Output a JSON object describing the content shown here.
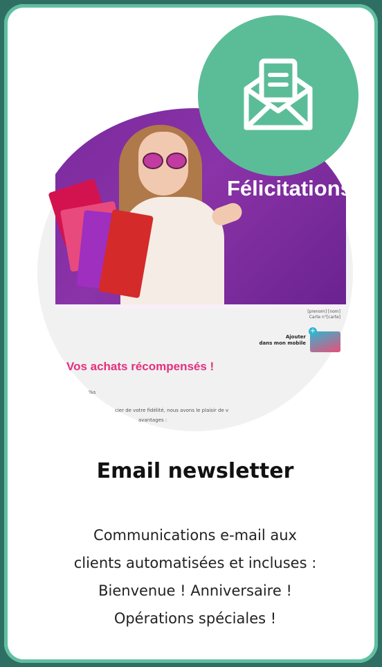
{
  "preview": {
    "hero_title": "Félicitations",
    "meta_line_1": "[prenom] [nom]",
    "meta_line_2": "Carte n°[carte]",
    "mobile_line_1": "Ajouter",
    "mobile_line_2": "dans mon mobile",
    "rewards_title": "Vos achats récompensés !",
    "body_line_1": "%s",
    "body_line_2": "cier de votre fidélité, nous avons le plaisir de v",
    "body_line_3": "avantages :"
  },
  "badge": {
    "icon": "envelope-document-icon",
    "color": "#5bbd98"
  },
  "title": "Email newsletter",
  "description": [
    "Communications e-mail aux",
    "clients automatisées et incluses :",
    "Bienvenue ! Anniversaire !",
    "Opérations spéciales !"
  ],
  "colors": {
    "accent": "#5bbd98",
    "hero": "#7a2a9e",
    "rewards": "#e3307c",
    "border": "#5fbfa0"
  }
}
